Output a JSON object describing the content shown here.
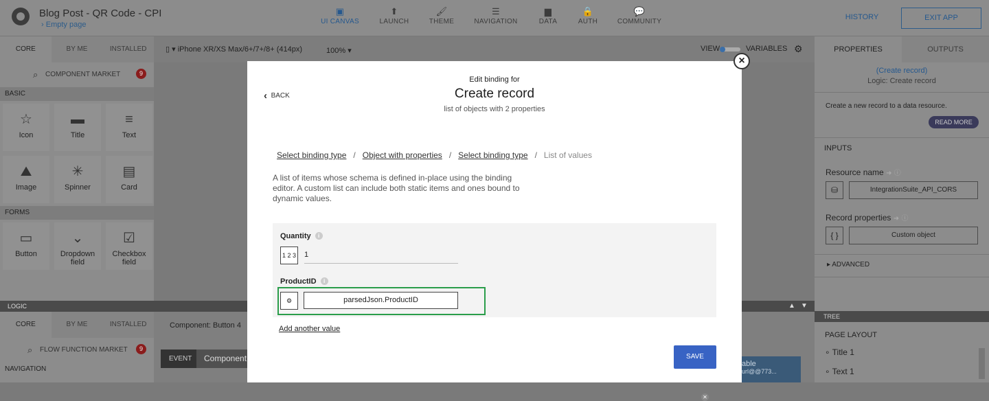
{
  "app": {
    "title": "Blog Post - QR Code - CPI",
    "page": "Empty page"
  },
  "nav_tabs": [
    {
      "label": "UI CANVAS",
      "icon": "▣"
    },
    {
      "label": "LAUNCH",
      "icon": "⬆"
    },
    {
      "label": "THEME",
      "icon": "🖌"
    },
    {
      "label": "NAVIGATION",
      "icon": "☰"
    },
    {
      "label": "DATA",
      "icon": "▆"
    },
    {
      "label": "AUTH",
      "icon": "🔒"
    },
    {
      "label": "COMMUNITY",
      "icon": "💬"
    }
  ],
  "top_actions": {
    "history": "HISTORY",
    "exit": "EXIT APP"
  },
  "left_panel": {
    "tabs": [
      "CORE",
      "BY ME",
      "INSTALLED"
    ],
    "market": "COMPONENT MARKET",
    "market_badge": "9",
    "section_basic": "BASIC",
    "basic": [
      {
        "label": "Icon",
        "icon": "☆"
      },
      {
        "label": "Title",
        "icon": "▬"
      },
      {
        "label": "Text",
        "icon": "≡"
      },
      {
        "label": "Image",
        "icon": "⛰"
      },
      {
        "label": "Spinner",
        "icon": "✳"
      },
      {
        "label": "Card",
        "icon": "▤"
      }
    ],
    "section_forms": "FORMS",
    "forms": [
      {
        "label": "Button",
        "icon": "▭"
      },
      {
        "label": "Dropdown field",
        "icon": "⌄"
      },
      {
        "label": "Checkbox field",
        "icon": "☑"
      }
    ]
  },
  "logic_bar": {
    "label": "LOGIC"
  },
  "logic_panel": {
    "tabs": [
      "CORE",
      "BY ME",
      "INSTALLED"
    ],
    "market": "FLOW FUNCTION MARKET",
    "market_badge": "9",
    "section": "NAVIGATION"
  },
  "canvas_bar": {
    "device": "iPhone XR/XS Max/6+/7+/8+ (414px)",
    "zoom": "100%",
    "view": "VIEW",
    "variables": "VARIABLES"
  },
  "lower_bar": {
    "component": "Component: Button 4",
    "event_tab": "EVENT",
    "component_tab": "Component"
  },
  "right_panel": {
    "tabs": [
      "PROPERTIES",
      "OUTPUTS"
    ],
    "link": "(Create record)",
    "logic": "Logic: Create record",
    "description": "Create a new record to a data resource.",
    "read_more": "READ MORE",
    "inputs": "INPUTS",
    "resource_name_label": "Resource name",
    "resource_name_value": "IntegrationSuite_API_CORS",
    "record_props_label": "Record properties",
    "record_props_value": "Custom object",
    "advanced": "ADVANCED"
  },
  "tree": {
    "bar": "TREE",
    "layout": "PAGE LAYOUT",
    "items": [
      "Title 1",
      "Text 1"
    ]
  },
  "tooltip": {
    "line1": "able",
    "line2": "url@@773..."
  },
  "modal": {
    "subtitle": "Edit binding for",
    "title": "Create record",
    "description": "list of objects with 2 properties",
    "back": "BACK",
    "breadcrumb": [
      "Select binding type",
      "Object with properties",
      "Select binding type",
      "List of values"
    ],
    "text": "A list of items whose schema is defined in-place using the binding editor. A custom list can include both static items and ones bound to dynamic values.",
    "fields": [
      {
        "label": "Quantity",
        "type_icon": "1 2 3",
        "value": "1"
      },
      {
        "label": "ProductID",
        "type_icon": "⚙",
        "value": "parsedJson.ProductID"
      }
    ],
    "add_value": "Add another value",
    "save": "SAVE"
  }
}
